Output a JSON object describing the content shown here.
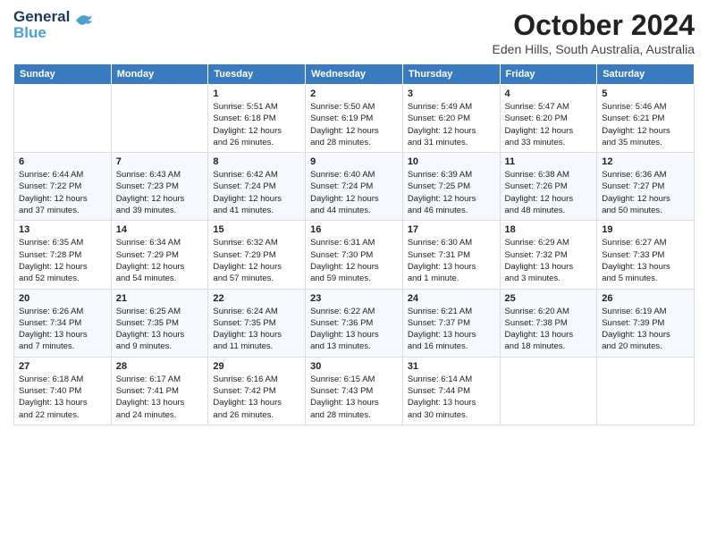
{
  "header": {
    "logo_line1": "General",
    "logo_line2": "Blue",
    "title": "October 2024",
    "subtitle": "Eden Hills, South Australia, Australia"
  },
  "columns": [
    "Sunday",
    "Monday",
    "Tuesday",
    "Wednesday",
    "Thursday",
    "Friday",
    "Saturday"
  ],
  "weeks": [
    [
      {
        "day": "",
        "content": ""
      },
      {
        "day": "",
        "content": ""
      },
      {
        "day": "1",
        "content": "Sunrise: 5:51 AM\nSunset: 6:18 PM\nDaylight: 12 hours\nand 26 minutes."
      },
      {
        "day": "2",
        "content": "Sunrise: 5:50 AM\nSunset: 6:19 PM\nDaylight: 12 hours\nand 28 minutes."
      },
      {
        "day": "3",
        "content": "Sunrise: 5:49 AM\nSunset: 6:20 PM\nDaylight: 12 hours\nand 31 minutes."
      },
      {
        "day": "4",
        "content": "Sunrise: 5:47 AM\nSunset: 6:20 PM\nDaylight: 12 hours\nand 33 minutes."
      },
      {
        "day": "5",
        "content": "Sunrise: 5:46 AM\nSunset: 6:21 PM\nDaylight: 12 hours\nand 35 minutes."
      }
    ],
    [
      {
        "day": "6",
        "content": "Sunrise: 6:44 AM\nSunset: 7:22 PM\nDaylight: 12 hours\nand 37 minutes."
      },
      {
        "day": "7",
        "content": "Sunrise: 6:43 AM\nSunset: 7:23 PM\nDaylight: 12 hours\nand 39 minutes."
      },
      {
        "day": "8",
        "content": "Sunrise: 6:42 AM\nSunset: 7:24 PM\nDaylight: 12 hours\nand 41 minutes."
      },
      {
        "day": "9",
        "content": "Sunrise: 6:40 AM\nSunset: 7:24 PM\nDaylight: 12 hours\nand 44 minutes."
      },
      {
        "day": "10",
        "content": "Sunrise: 6:39 AM\nSunset: 7:25 PM\nDaylight: 12 hours\nand 46 minutes."
      },
      {
        "day": "11",
        "content": "Sunrise: 6:38 AM\nSunset: 7:26 PM\nDaylight: 12 hours\nand 48 minutes."
      },
      {
        "day": "12",
        "content": "Sunrise: 6:36 AM\nSunset: 7:27 PM\nDaylight: 12 hours\nand 50 minutes."
      }
    ],
    [
      {
        "day": "13",
        "content": "Sunrise: 6:35 AM\nSunset: 7:28 PM\nDaylight: 12 hours\nand 52 minutes."
      },
      {
        "day": "14",
        "content": "Sunrise: 6:34 AM\nSunset: 7:29 PM\nDaylight: 12 hours\nand 54 minutes."
      },
      {
        "day": "15",
        "content": "Sunrise: 6:32 AM\nSunset: 7:29 PM\nDaylight: 12 hours\nand 57 minutes."
      },
      {
        "day": "16",
        "content": "Sunrise: 6:31 AM\nSunset: 7:30 PM\nDaylight: 12 hours\nand 59 minutes."
      },
      {
        "day": "17",
        "content": "Sunrise: 6:30 AM\nSunset: 7:31 PM\nDaylight: 13 hours\nand 1 minute."
      },
      {
        "day": "18",
        "content": "Sunrise: 6:29 AM\nSunset: 7:32 PM\nDaylight: 13 hours\nand 3 minutes."
      },
      {
        "day": "19",
        "content": "Sunrise: 6:27 AM\nSunset: 7:33 PM\nDaylight: 13 hours\nand 5 minutes."
      }
    ],
    [
      {
        "day": "20",
        "content": "Sunrise: 6:26 AM\nSunset: 7:34 PM\nDaylight: 13 hours\nand 7 minutes."
      },
      {
        "day": "21",
        "content": "Sunrise: 6:25 AM\nSunset: 7:35 PM\nDaylight: 13 hours\nand 9 minutes."
      },
      {
        "day": "22",
        "content": "Sunrise: 6:24 AM\nSunset: 7:35 PM\nDaylight: 13 hours\nand 11 minutes."
      },
      {
        "day": "23",
        "content": "Sunrise: 6:22 AM\nSunset: 7:36 PM\nDaylight: 13 hours\nand 13 minutes."
      },
      {
        "day": "24",
        "content": "Sunrise: 6:21 AM\nSunset: 7:37 PM\nDaylight: 13 hours\nand 16 minutes."
      },
      {
        "day": "25",
        "content": "Sunrise: 6:20 AM\nSunset: 7:38 PM\nDaylight: 13 hours\nand 18 minutes."
      },
      {
        "day": "26",
        "content": "Sunrise: 6:19 AM\nSunset: 7:39 PM\nDaylight: 13 hours\nand 20 minutes."
      }
    ],
    [
      {
        "day": "27",
        "content": "Sunrise: 6:18 AM\nSunset: 7:40 PM\nDaylight: 13 hours\nand 22 minutes."
      },
      {
        "day": "28",
        "content": "Sunrise: 6:17 AM\nSunset: 7:41 PM\nDaylight: 13 hours\nand 24 minutes."
      },
      {
        "day": "29",
        "content": "Sunrise: 6:16 AM\nSunset: 7:42 PM\nDaylight: 13 hours\nand 26 minutes."
      },
      {
        "day": "30",
        "content": "Sunrise: 6:15 AM\nSunset: 7:43 PM\nDaylight: 13 hours\nand 28 minutes."
      },
      {
        "day": "31",
        "content": "Sunrise: 6:14 AM\nSunset: 7:44 PM\nDaylight: 13 hours\nand 30 minutes."
      },
      {
        "day": "",
        "content": ""
      },
      {
        "day": "",
        "content": ""
      }
    ]
  ]
}
